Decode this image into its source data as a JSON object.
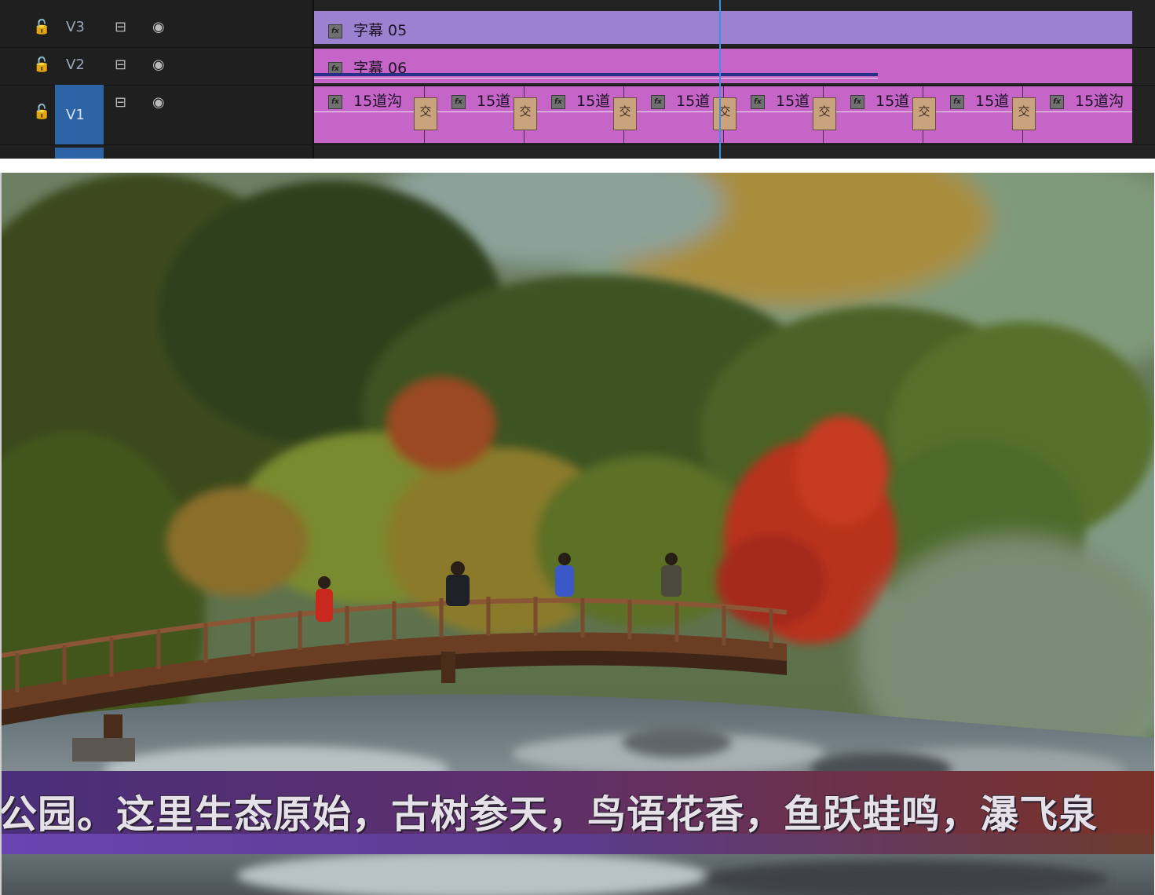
{
  "timeline": {
    "tracks": [
      {
        "name": "V3",
        "clip": "字幕 05"
      },
      {
        "name": "V2",
        "clip": "字幕 06"
      },
      {
        "name": "V1"
      }
    ],
    "fx_label": "fx",
    "v1_clips": [
      "15道沟",
      "15道",
      "15道",
      "15道",
      "15道",
      "15道",
      "15道",
      "15道沟"
    ],
    "transition_label": "交"
  },
  "preview": {
    "subtitle": "公园。这里生态原始，古树参天，鸟语花香，鱼跃蛙鸣，瀑飞泉"
  },
  "colors": {
    "v3_clip": "#9a82d0",
    "v2_v1_clip": "#c565c8",
    "target_highlight": "#2c64a6",
    "playhead": "#3f8fe0",
    "transition": "#c9a27e"
  }
}
